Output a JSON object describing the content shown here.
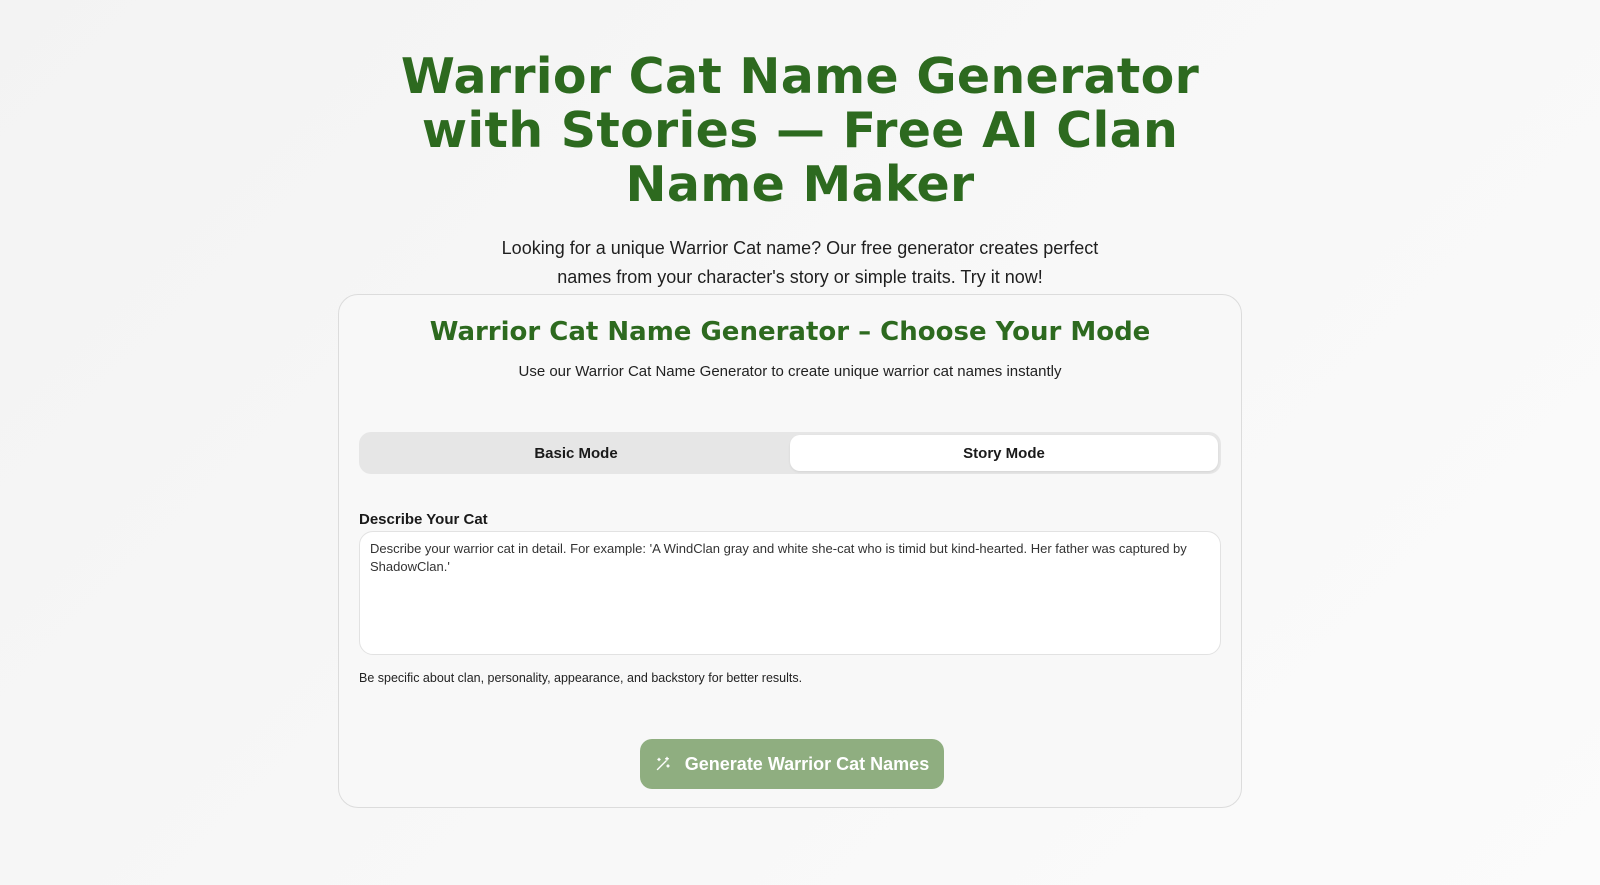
{
  "hero": {
    "title": "Warrior Cat Name Generator with Stories — Free AI Clan Name Maker",
    "subtitle": "Looking for a unique Warrior Cat name? Our free generator creates perfect names from your character's story or simple traits. Try it now!"
  },
  "generator": {
    "title": "Warrior Cat Name Generator – Choose Your Mode",
    "subtitle": "Use our Warrior Cat Name Generator to create unique warrior cat names instantly",
    "modes": [
      {
        "label": "Basic Mode",
        "active": false
      },
      {
        "label": "Story Mode",
        "active": true
      }
    ],
    "description_label": "Describe Your Cat",
    "description_placeholder": "Describe your warrior cat in detail. For example: 'A WindClan gray and white she-cat who is timid but kind-hearted. Her father was captured by ShadowClan.'",
    "description_value": "",
    "hint": "Be specific about clan, personality, appearance, and backstory for better results.",
    "generate_label": "Generate Warrior Cat Names",
    "generate_icon": "magic-wand-icon"
  },
  "colors": {
    "accent": "#2d6a1f",
    "button": "#8fae80"
  }
}
